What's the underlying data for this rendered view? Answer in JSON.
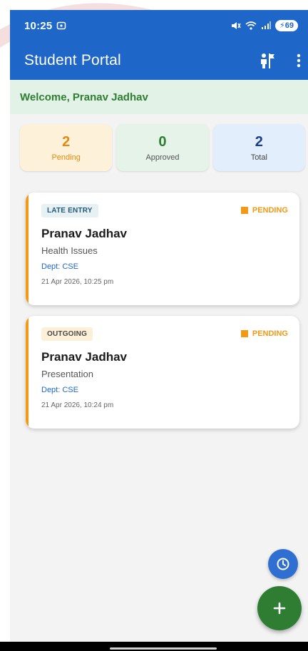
{
  "status_bar": {
    "time": "10:25",
    "battery": "69"
  },
  "app": {
    "title": "Student Portal"
  },
  "welcome": {
    "text": "Welcome, Pranav Jadhav"
  },
  "stats": [
    {
      "value": "2",
      "label": "Pending"
    },
    {
      "value": "0",
      "label": "Approved"
    },
    {
      "value": "2",
      "label": "Total"
    }
  ],
  "requests": [
    {
      "type": "LATE ENTRY",
      "status": "PENDING",
      "name": "Pranav Jadhav",
      "reason": "Health Issues",
      "dept": "Dept: CSE",
      "date": "21 Apr 2026, 10:25 pm"
    },
    {
      "type": "OUTGOING",
      "status": "PENDING",
      "name": "Pranav Jadhav",
      "reason": "Presentation",
      "dept": "Dept: CSE",
      "date": "21 Apr 2026, 10:24 pm"
    }
  ],
  "icons": {
    "appbar_action": "person-signpost-icon",
    "overflow": "more-vert-icon",
    "history_fab": "clock-icon",
    "add_fab": "plus-icon"
  },
  "colors": {
    "primary": "#1f66c9",
    "success": "#2e7d32",
    "pending": "#f29a16"
  }
}
